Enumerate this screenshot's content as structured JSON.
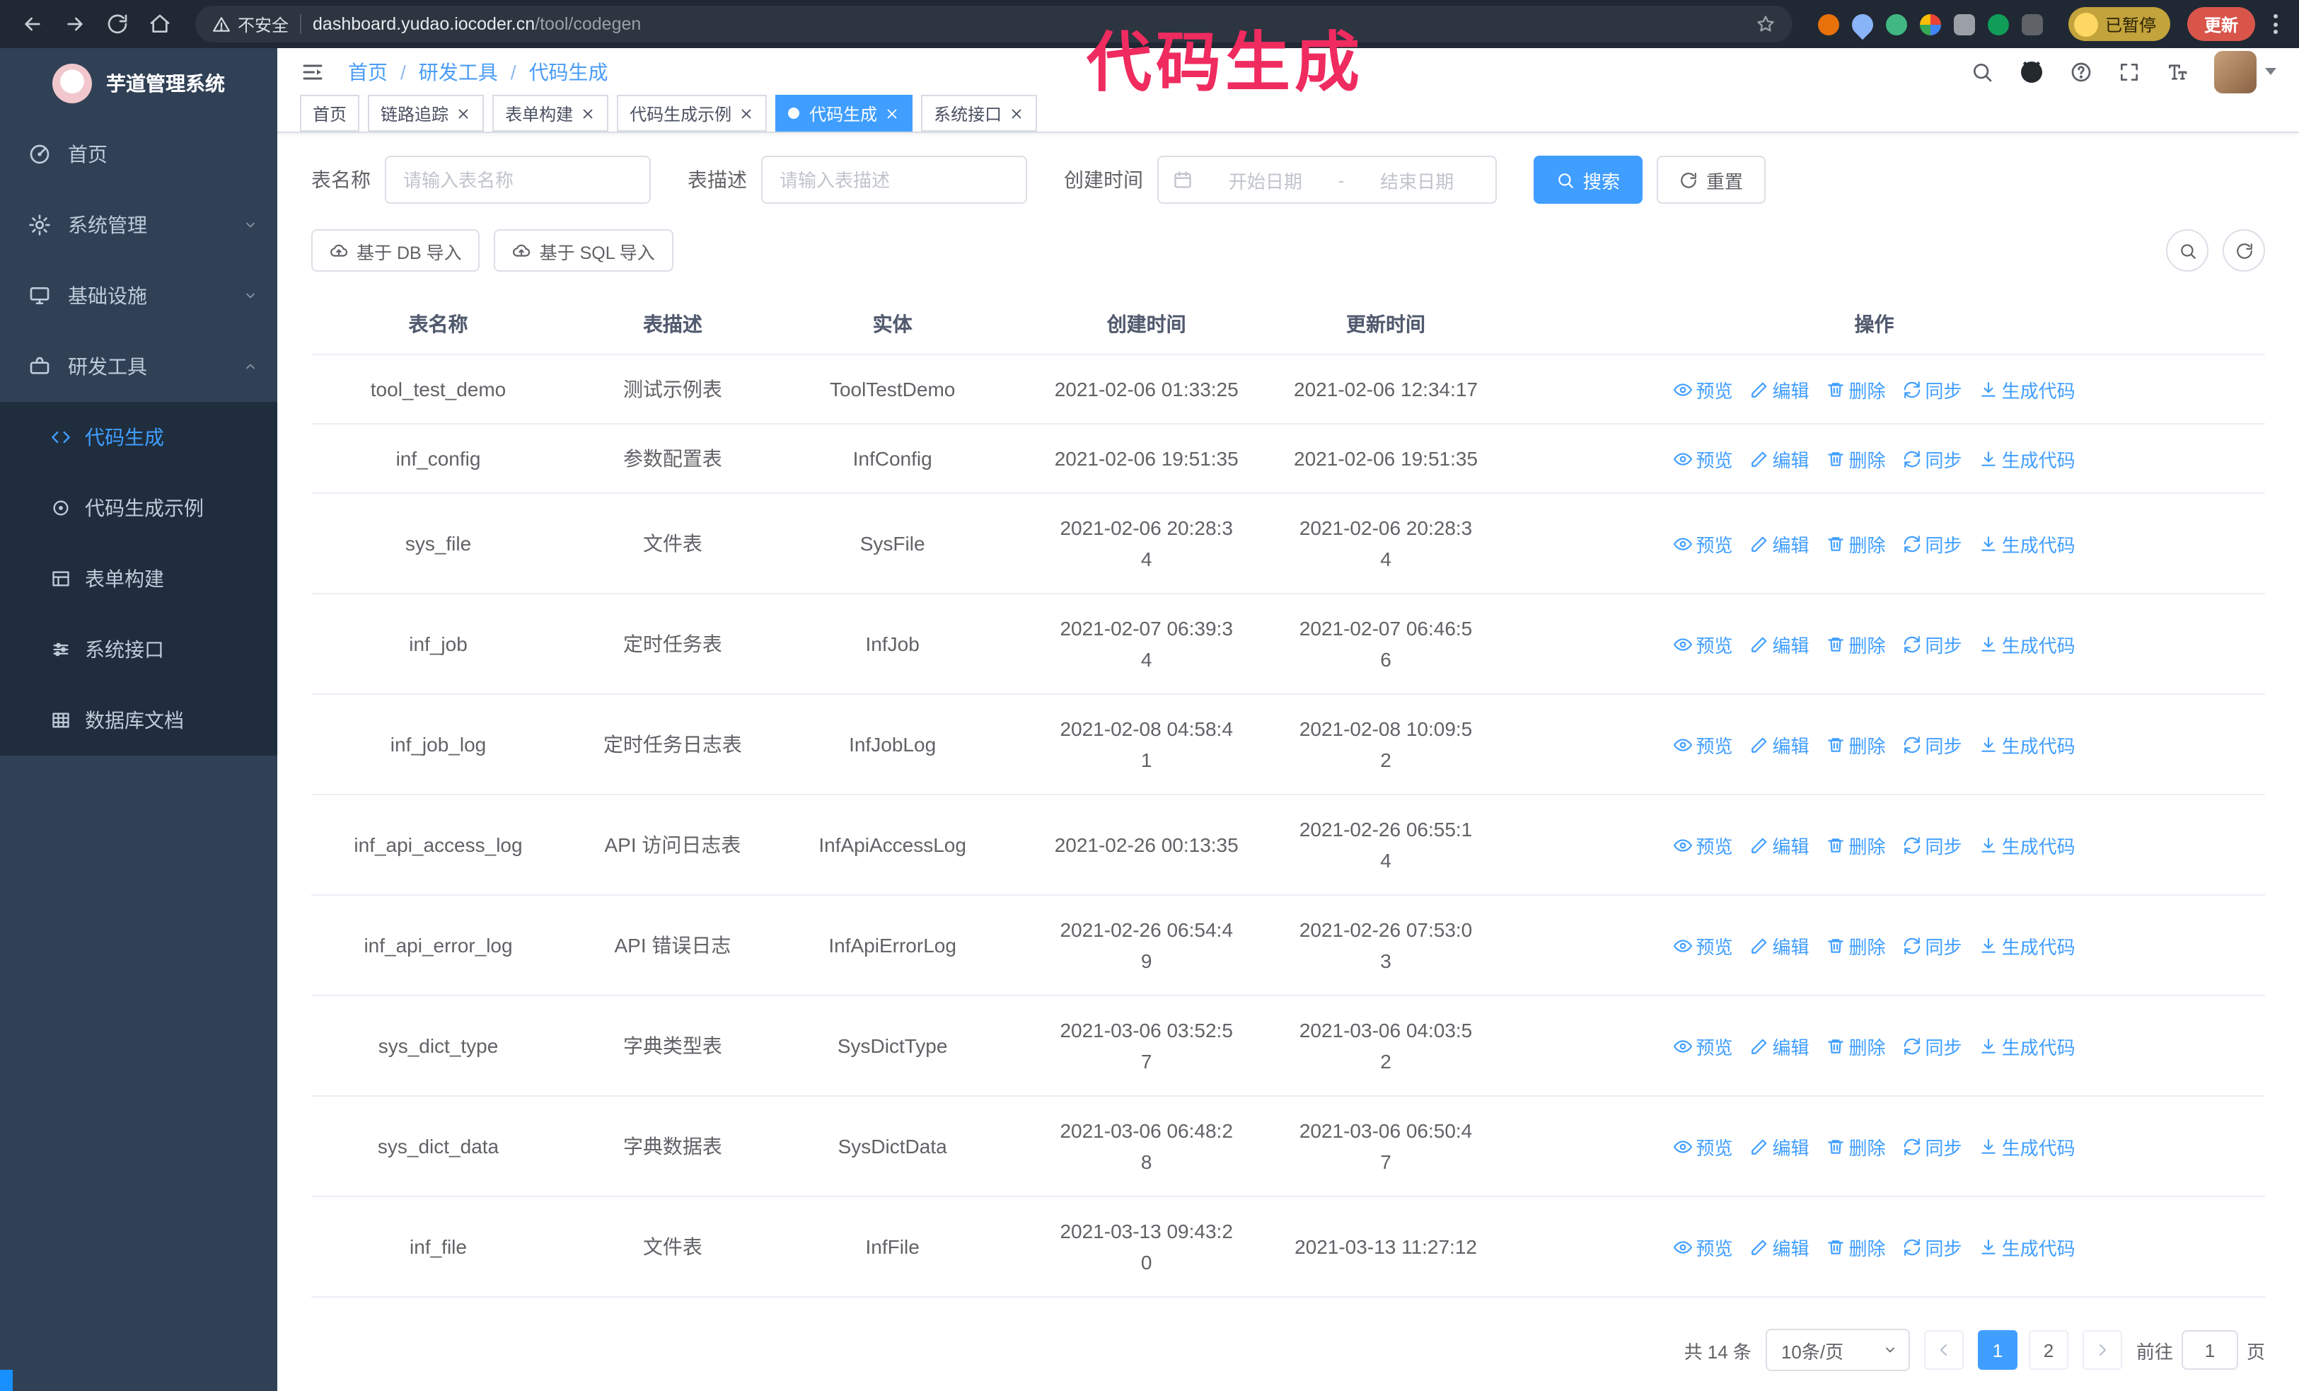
{
  "colors": {
    "accent": "#409eff",
    "annotation": "#ef2b5f",
    "sidebar_bg": "#304156",
    "submenu_bg": "#1f2d3d",
    "chrome_bg": "#202833",
    "chrome_field": "#2c3540",
    "update_red": "#d9554a",
    "paused_yellow": "#c2a33c"
  },
  "browser": {
    "security_label": "不安全",
    "url_host": "dashboard.yudao.iocoder.cn",
    "url_path": "/tool/codegen",
    "paused_badge": "已暂停",
    "update_button": "更新"
  },
  "annotation": {
    "text": "代码生成"
  },
  "sidebar": {
    "logo_title": "芋道管理系统",
    "items": [
      {
        "label": "首页"
      },
      {
        "label": "系统管理"
      },
      {
        "label": "基础设施"
      },
      {
        "label": "研发工具",
        "expanded": true
      }
    ],
    "sub_items": [
      {
        "label": "代码生成",
        "active": true
      },
      {
        "label": "代码生成示例"
      },
      {
        "label": "表单构建"
      },
      {
        "label": "系统接口"
      },
      {
        "label": "数据库文档"
      }
    ]
  },
  "navbar": {
    "separator": "/",
    "breadcrumb": [
      {
        "label": "首页"
      },
      {
        "label": "研发工具"
      },
      {
        "label": "代码生成"
      }
    ]
  },
  "tags": [
    {
      "label": "首页",
      "closable": false
    },
    {
      "label": "链路追踪",
      "closable": true
    },
    {
      "label": "表单构建",
      "closable": true
    },
    {
      "label": "代码生成示例",
      "closable": true
    },
    {
      "label": "代码生成",
      "closable": true,
      "active": true
    },
    {
      "label": "系统接口",
      "closable": true
    }
  ],
  "filters": {
    "table_name_label": "表名称",
    "table_name_placeholder": "请输入表名称",
    "table_desc_label": "表描述",
    "table_desc_placeholder": "请输入表描述",
    "create_time_label": "创建时间",
    "date_start_placeholder": "开始日期",
    "date_separator": "-",
    "date_end_placeholder": "结束日期",
    "search_button": "搜索",
    "reset_button": "重置"
  },
  "toolbar": {
    "import_db": "基于 DB 导入",
    "import_sql": "基于 SQL 导入"
  },
  "table": {
    "columns": [
      "表名称",
      "表描述",
      "实体",
      "创建时间",
      "更新时间",
      "操作"
    ],
    "actions": [
      "预览",
      "编辑",
      "删除",
      "同步",
      "生成代码"
    ],
    "rows": [
      {
        "name": "tool_test_demo",
        "desc": "测试示例表",
        "entity": "ToolTestDemo",
        "created": "2021-02-06 01:33:25",
        "updated": "2021-02-06 12:34:17"
      },
      {
        "name": "inf_config",
        "desc": "参数配置表",
        "entity": "InfConfig",
        "created": "2021-02-06 19:51:35",
        "updated": "2021-02-06 19:51:35"
      },
      {
        "name": "sys_file",
        "desc": "文件表",
        "entity": "SysFile",
        "created": "2021-02-06 20:28:3\n4",
        "updated": "2021-02-06 20:28:3\n4"
      },
      {
        "name": "inf_job",
        "desc": "定时任务表",
        "entity": "InfJob",
        "created": "2021-02-07 06:39:3\n4",
        "updated": "2021-02-07 06:46:5\n6"
      },
      {
        "name": "inf_job_log",
        "desc": "定时任务日志表",
        "entity": "InfJobLog",
        "created": "2021-02-08 04:58:4\n1",
        "updated": "2021-02-08 10:09:5\n2"
      },
      {
        "name": "inf_api_access_log",
        "desc": "API 访问日志表",
        "entity": "InfApiAccessLog",
        "created": "2021-02-26 00:13:35",
        "updated": "2021-02-26 06:55:1\n4"
      },
      {
        "name": "inf_api_error_log",
        "desc": "API 错误日志",
        "entity": "InfApiErrorLog",
        "created": "2021-02-26 06:54:4\n9",
        "updated": "2021-02-26 07:53:0\n3"
      },
      {
        "name": "sys_dict_type",
        "desc": "字典类型表",
        "entity": "SysDictType",
        "created": "2021-03-06 03:52:5\n7",
        "updated": "2021-03-06 04:03:5\n2"
      },
      {
        "name": "sys_dict_data",
        "desc": "字典数据表",
        "entity": "SysDictData",
        "created": "2021-03-06 06:48:2\n8",
        "updated": "2021-03-06 06:50:4\n7"
      },
      {
        "name": "inf_file",
        "desc": "文件表",
        "entity": "InfFile",
        "created": "2021-03-13 09:43:2\n0",
        "updated": "2021-03-13 11:27:12"
      }
    ]
  },
  "pagination": {
    "total": "共 14 条",
    "page_size": "10条/页",
    "pages": [
      {
        "label": "1",
        "active": true
      },
      {
        "label": "2"
      }
    ],
    "active_page": "1",
    "goto_label": "前往",
    "goto_value": "1",
    "goto_suffix": "页"
  }
}
